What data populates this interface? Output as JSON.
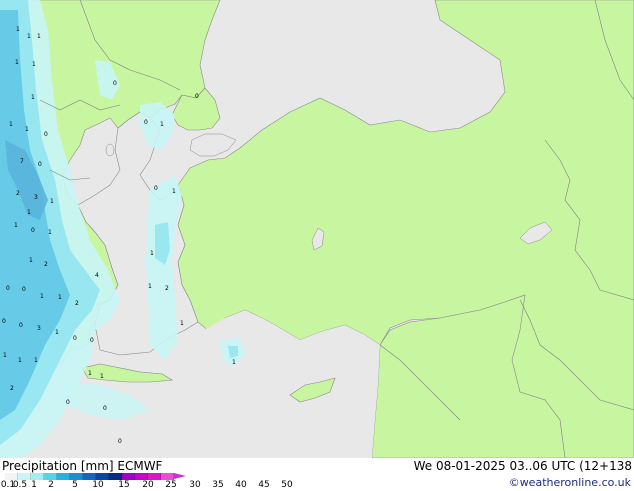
{
  "title": {
    "left": "Precipitation [mm]  ECMWF",
    "right": "We 08-01-2025 03..06 UTC (12+138"
  },
  "credit": "©weatheronline.co.uk",
  "legend": {
    "ticks": [
      "0.1",
      "0.5",
      "1",
      "2",
      "5",
      "10",
      "15",
      "20",
      "25",
      "30",
      "35",
      "40",
      "45",
      "50"
    ],
    "colors": [
      "#f4f4f4",
      "#c8f5f5",
      "#a0eef0",
      "#5ad2ec",
      "#28b0e0",
      "#1e8ed4",
      "#1466c0",
      "#0a46a8",
      "#06288a",
      "#a000c8",
      "#c800c8",
      "#dc14c8",
      "#e650d2",
      "#cc33cc"
    ]
  },
  "map_values": [
    "1",
    "1",
    "1",
    "1",
    "1",
    "0",
    "1",
    "1",
    "1",
    "0",
    "7",
    "0",
    "2",
    "3",
    "1",
    "1",
    "1",
    "0",
    "1",
    "2",
    "1",
    "4",
    "1",
    "2",
    "0",
    "0",
    "1",
    "0",
    "0",
    "1",
    "1",
    "1",
    "3",
    "1",
    "2",
    "0",
    "0",
    "1",
    "1",
    "1",
    "2",
    "1",
    "0",
    "1",
    "1",
    "1",
    "0",
    "0",
    "0",
    "0",
    "0",
    "1"
  ],
  "colors": {
    "land": "#c8f5a0",
    "outside_land": "#e6e6e6",
    "precip_light": "#c8f5f5",
    "precip_moderate": "#96e6f0",
    "precip_heavy": "#64c8e6",
    "border": "#808080"
  }
}
